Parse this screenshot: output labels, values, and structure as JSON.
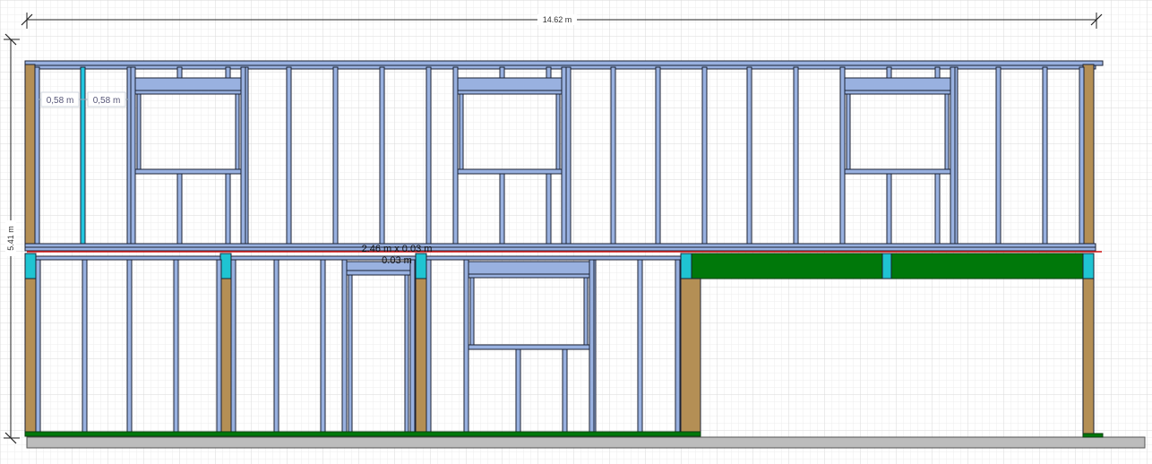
{
  "dimensions": {
    "total_width": "14.62 m",
    "total_height": "5.41 m",
    "spacing_left": "0,58 m",
    "spacing_right": "0,58 m",
    "beam_size": "2.46 m x 0.03 m",
    "beam_thickness": "0.03 m"
  },
  "colors": {
    "grid_minor": "#ececec",
    "grid_major": "#dadada",
    "stud_fill": "#99b1e0",
    "stud_stroke": "#1c2233",
    "post_fill": "#b48f55",
    "beam_fill": "#00780a",
    "connector_fill": "#1fc4d2",
    "ground_fill": "#bcbcbc",
    "selection_line": "#d21414",
    "dimension_line": "#222222",
    "highlight_stud": "#22c7e0"
  }
}
